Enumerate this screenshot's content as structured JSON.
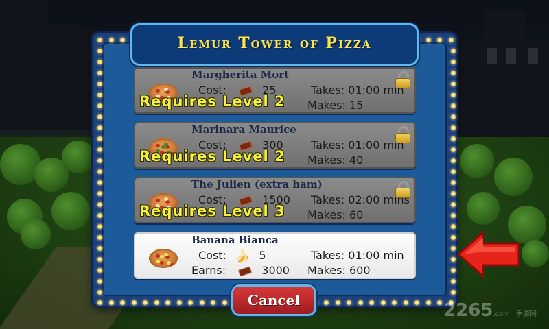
{
  "dialog": {
    "title": "Lemur Tower of Pizza",
    "recipes": [
      {
        "name": "Margherita Mort",
        "locked": true,
        "pizza_style": "cheese",
        "cost_label": "Cost:",
        "cost_icon": "ticket-icon",
        "cost_value": "25",
        "takes_label": "Takes:",
        "takes_value": "01:00 min",
        "makes_label": "Makes:",
        "makes_value": "15",
        "requirement": "Requires Level 2"
      },
      {
        "name": "Marinara Maurice",
        "locked": true,
        "pizza_style": "veggie",
        "cost_label": "Cost:",
        "cost_icon": "ticket-icon",
        "cost_value": "300",
        "takes_label": "Takes:",
        "takes_value": "01:00 min",
        "makes_label": "Makes:",
        "makes_value": "40",
        "requirement": "Requires Level 2"
      },
      {
        "name": "The Julien (extra ham)",
        "locked": true,
        "pizza_style": "ham",
        "cost_label": "Cost:",
        "cost_icon": "ticket-icon",
        "cost_value": "1500",
        "takes_label": "Takes:",
        "takes_value": "02:00 mins",
        "makes_label": "Makes:",
        "makes_value": "60",
        "requirement": "Requires Level 3"
      },
      {
        "name": "Banana Bianca",
        "locked": false,
        "pizza_style": "banana",
        "cost_label": "Cost:",
        "cost_icon": "banana-icon",
        "cost_value": "5",
        "takes_label": "Takes:",
        "takes_value": "01:00 min",
        "earns_label": "Earns:",
        "earns_icon": "ticket-icon",
        "earns_value": "3000",
        "makes_label": "Makes:",
        "makes_value": "600"
      }
    ],
    "cancel_label": "Cancel"
  },
  "watermark": {
    "text": "2265",
    "sub": "手游网",
    "domain": ".com"
  },
  "colors": {
    "title": "#ffe54a",
    "frame": "#1a3f7a",
    "requirement": "#f7ef3a",
    "cancel": "#c22a2e",
    "arrow": "#e8231b"
  }
}
